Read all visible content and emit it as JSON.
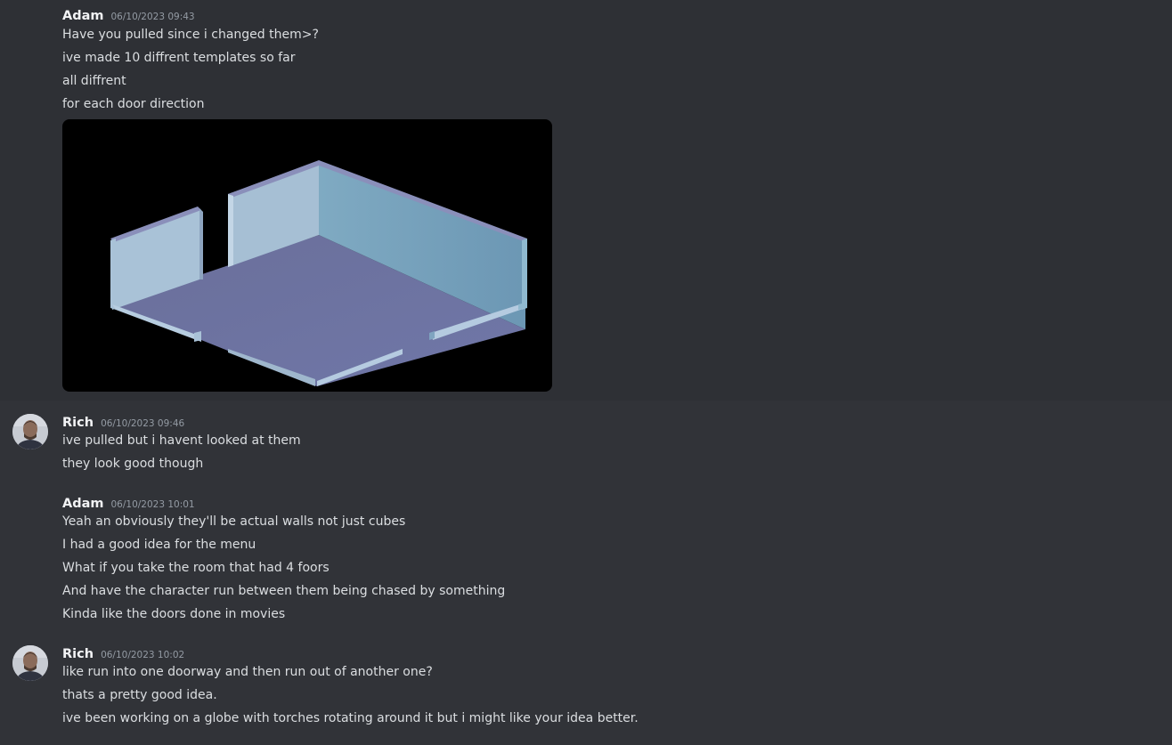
{
  "messages": [
    {
      "author": "Adam",
      "timestamp": "06/10/2023 09:43",
      "lines": [
        "Have you pulled since i changed them>?",
        "ive made 10 diffrent templates so far",
        "all diffrent",
        "for each door direction"
      ],
      "attachment": "3d-room-template-render"
    },
    {
      "author": "Rich",
      "timestamp": "06/10/2023 09:46",
      "lines": [
        "ive pulled but i havent looked at them",
        "they look good though"
      ]
    },
    {
      "author": "Adam",
      "timestamp": "06/10/2023 10:01",
      "lines": [
        "Yeah an obviously they'll be actual walls not just cubes",
        "I had a good idea for the menu",
        "What if you take the room that had 4 foors",
        "And have the character run between them being chased by something",
        "Kinda like the doors done in movies"
      ]
    },
    {
      "author": "Rich",
      "timestamp": "06/10/2023 10:02",
      "lines": [
        "like run into one doorway and then run out of another one?",
        "thats a pretty good idea.",
        "ive been working on a globe with torches rotating around it but i might like your idea better."
      ]
    }
  ],
  "colors": {
    "background": "#313338",
    "hover_background": "#2e3035",
    "author": "#f2f3f5",
    "timestamp": "#949ba4",
    "text": "#dbdee1"
  }
}
